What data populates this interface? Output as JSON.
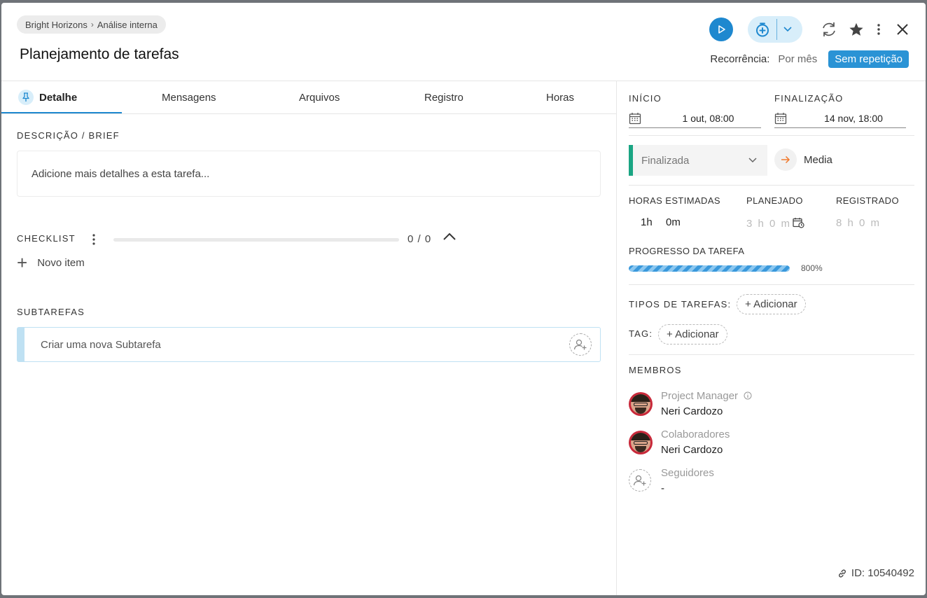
{
  "header": {
    "breadcrumb": {
      "project": "Bright Horizons",
      "section": "Análise interna"
    },
    "title": "Planejamento de tarefas",
    "recurrence": {
      "label": "Recorrência:",
      "value": "Por mês",
      "badge": "Sem repetição"
    }
  },
  "tabs": [
    {
      "label": "Detalhe",
      "active": true
    },
    {
      "label": "Mensagens"
    },
    {
      "label": "Arquivos"
    },
    {
      "label": "Registro"
    },
    {
      "label": "Horas"
    }
  ],
  "main": {
    "description": {
      "label": "DESCRIÇÃO / BRIEF",
      "placeholder": "Adicione mais detalhes a esta tarefa..."
    },
    "checklist": {
      "label": "CHECKLIST",
      "count": "0 / 0",
      "new_item": "Novo item"
    },
    "subtasks": {
      "label": "SUBTAREFAS",
      "placeholder": "Criar uma nova Subtarefa"
    }
  },
  "side": {
    "start": {
      "label": "INÍCIO",
      "value": "1 out, 08:00"
    },
    "end": {
      "label": "FINALIZAÇÃO",
      "value": "14 nov, 18:00"
    },
    "status": {
      "value": "Finalizada",
      "color": "#1aa583"
    },
    "priority": {
      "value": "Media"
    },
    "hours": {
      "estimated_label": "HORAS ESTIMADAS",
      "estimated_h": "1h",
      "estimated_m": "0m",
      "planned_label": "PLANEJADO",
      "planned_value": "3 h 0 m",
      "registered_label": "REGISTRADO",
      "registered_value": "8 h 0 m"
    },
    "progress": {
      "label": "PROGRESSO DA TAREFA",
      "percent_text": "800%",
      "percent": 800
    },
    "task_types": {
      "label": "TIPOS DE TAREFAS:",
      "add": "+ Adicionar"
    },
    "tag": {
      "label": "TAG:",
      "add": "+ Adicionar"
    },
    "members": {
      "label": "MEMBROS",
      "groups": [
        {
          "role": "Project Manager",
          "name": "Neri Cardozo"
        },
        {
          "role": "Colaboradores",
          "name": "Neri Cardozo"
        },
        {
          "role": "Seguidores",
          "name": "-"
        }
      ]
    },
    "task_id": "ID: 10540492"
  },
  "colors": {
    "accent": "#1e88cf",
    "badge": "#2a93d5",
    "status": "#1aa583",
    "priority_arrow": "#f07a2f"
  }
}
